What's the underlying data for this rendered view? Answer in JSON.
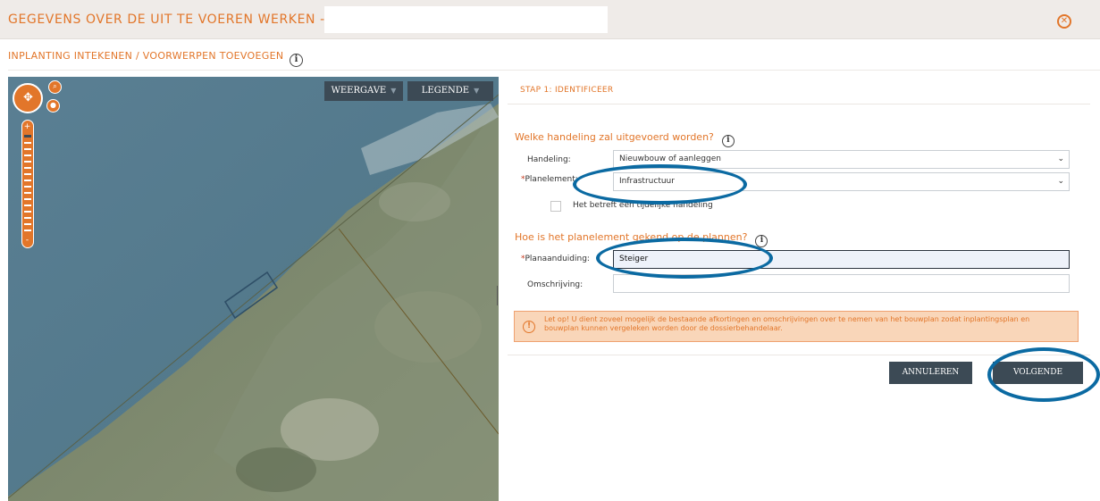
{
  "header": {
    "title": "GEGEVENS OVER DE UIT TE VOEREN WERKEN - LOCATIE:",
    "location_value": "",
    "close_icon": "close-circle-icon"
  },
  "subheader": {
    "title": "INPLANTING INTEKENEN / VOORWERPEN TOEVOEGEN",
    "info_icon": "info-icon"
  },
  "map": {
    "buttons": {
      "weergave": "WEERGAVE",
      "legende": "LEGENDE"
    },
    "zoom": {
      "plus": "+",
      "minus": "-"
    },
    "colors": {
      "water": "#5f8396",
      "land": "#7d8a6c",
      "controls": "#e2762a"
    }
  },
  "form": {
    "step_title": "STAP 1: IDENTIFICEER",
    "question1": "Welke handeling zal uitgevoerd worden?",
    "handeling_label": "Handeling:",
    "handeling_value": "Nieuwbouw of aanleggen",
    "planelement_label": "Planelement:",
    "planelement_value": "Infrastructuur",
    "required_mark": "*",
    "tijdelijk_label": "Het betreft een tijdelijke handeling",
    "question2": "Hoe is het planelement gekend op de plannen?",
    "planaanduiding_label": "Planaanduiding:",
    "planaanduiding_value": "Steiger",
    "omschrijving_label": "Omschrijving:",
    "omschrijving_value": "",
    "alert_text": "Let op! U dient zoveel mogelijk de bestaande afkortingen en omschrijvingen over te nemen van het bouwplan zodat inplantingsplan en bouwplan kunnen vergeleken worden door de dossierbehandelaar.",
    "cancel_label": "ANNULEREN",
    "next_label": "VOLGENDE"
  },
  "annotations": {
    "ring_color": "#0b6aa2"
  }
}
